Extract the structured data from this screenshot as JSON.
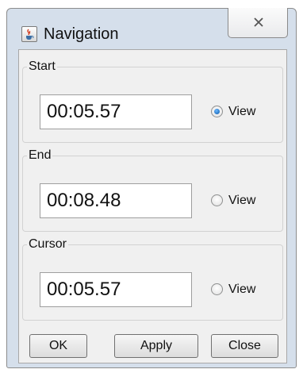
{
  "window": {
    "title": "Navigation"
  },
  "groups": {
    "start": {
      "label": "Start",
      "time": "00:05.57",
      "view_label": "View",
      "view_selected": true
    },
    "end": {
      "label": "End",
      "time": "00:08.48",
      "view_label": "View",
      "view_selected": false
    },
    "cursor": {
      "label": "Cursor",
      "time": "00:05.57",
      "view_label": "View",
      "view_selected": false
    }
  },
  "buttons": {
    "ok": "OK",
    "apply": "Apply",
    "close": "Close"
  },
  "icons": {
    "app": "java-cup-icon",
    "close": "close-x-icon"
  },
  "colors": {
    "frame": "#d5dfeb",
    "radio_checked": "#0b5aa8",
    "panel": "#f0f0f0"
  }
}
